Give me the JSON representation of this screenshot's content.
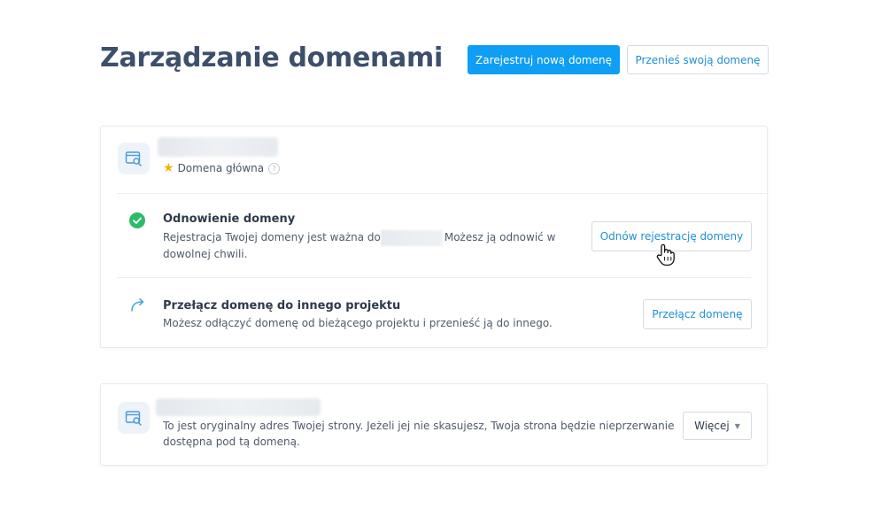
{
  "page": {
    "title": "Zarządzanie domenami"
  },
  "header": {
    "register_label": "Zarejestruj nową domenę",
    "transfer_label": "Przenieś swoją domenę"
  },
  "main_domain_card": {
    "badge": "Domena główna",
    "renewal": {
      "title": "Odnowienie domeny",
      "desc_before": "Rejestracja Twojej domeny jest ważna do",
      "desc_after": "Możesz ją odnowić w",
      "desc_line2": "dowolnej chwili.",
      "button": "Odnów rejestrację domeny"
    },
    "switch": {
      "title": "Przełącz domenę do innego projektu",
      "desc": "Możesz odłączyć domenę od bieżącego projektu i przenieść ją do innego.",
      "button": "Przełącz domenę"
    }
  },
  "original_domain_card": {
    "desc_line1": "To jest oryginalny adres Twojej strony. Jeżeli jej nie skasujesz, Twoja strona będzie nieprzerwanie",
    "desc_line2": "dostępna pod tą domeną.",
    "more_button": "Więcej"
  },
  "icons": {
    "domain": "domain-browser-icon",
    "star": "star-icon",
    "help": "help-circle-icon",
    "check": "check-circle-icon",
    "switch": "arrow-curve-icon",
    "caret": "caret-down-icon",
    "cursor": "hand-pointer-icon"
  },
  "colors": {
    "primary": "#0e9ef3",
    "link": "#1f8fd6",
    "success": "#2dbb6a",
    "star": "#f5b400",
    "title": "#3d4f6b"
  }
}
